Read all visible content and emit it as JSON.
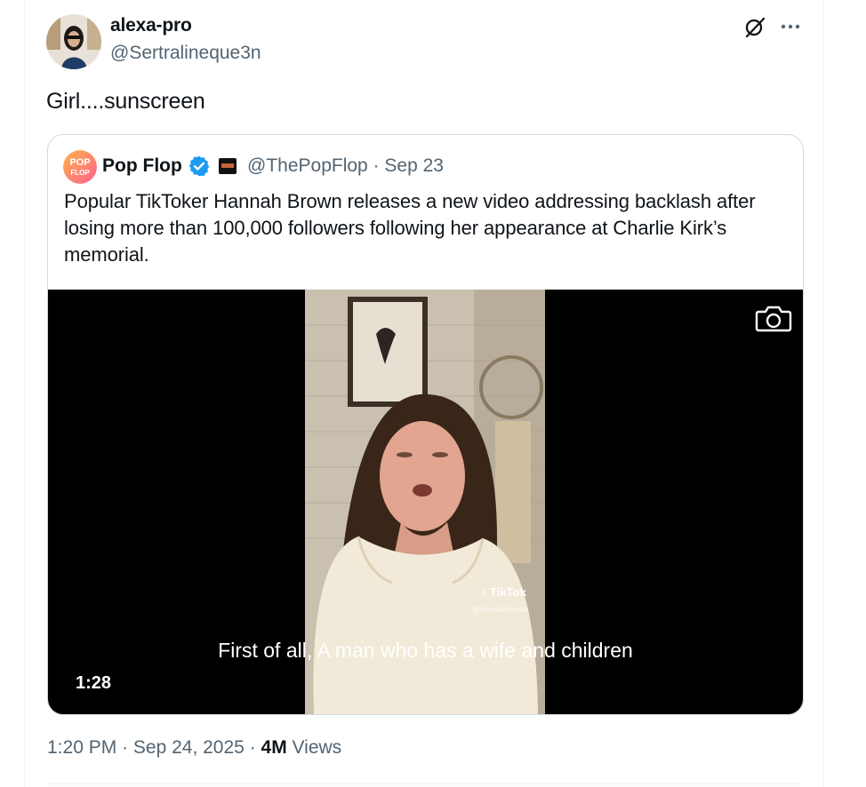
{
  "post": {
    "display_name": "alexa-pro",
    "handle": "@Sertralineque3n",
    "text": "Girl....sunscreen",
    "time": "1:20 PM",
    "date": "Sep 24, 2025",
    "views_count": "4M",
    "views_label": "Views"
  },
  "quote": {
    "display_name": "Pop Flop",
    "handle": "@ThePopFlop",
    "date": "Sep 23",
    "text": "Popular TikToker Hannah Brown releases a new video addressing backlash after losing more than 100,000 followers following her appearance at Charlie Kirk’s memorial.",
    "avatar_text": "POP FLOP",
    "video": {
      "duration": "1:28",
      "caption": "First of all, A man who has a wife and children",
      "watermark": "TikTok",
      "watermark_user": "@hannahbrown"
    }
  },
  "icons": {
    "grok": "grok-icon",
    "more": "more-icon",
    "verified": "verified-badge-icon",
    "camera": "camera-icon"
  },
  "colors": {
    "verified_blue": "#1d9bf0",
    "secondary_text": "#536471",
    "border": "#cfd9de"
  }
}
